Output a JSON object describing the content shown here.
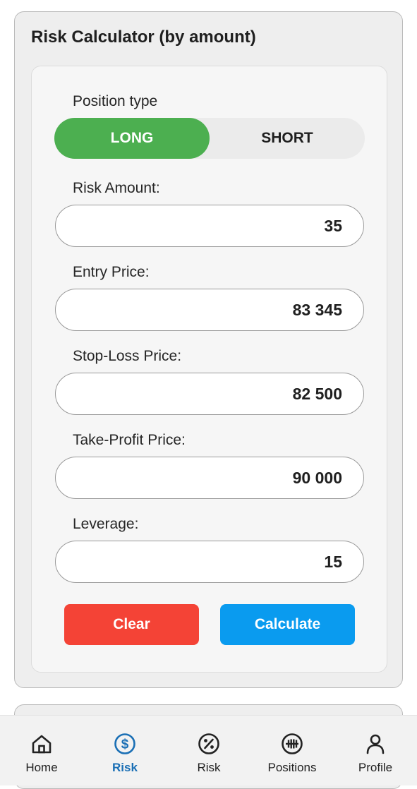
{
  "calculator": {
    "title": "Risk Calculator (by amount)",
    "position_type_label": "Position type",
    "position_options": [
      "LONG",
      "SHORT"
    ],
    "selected_position": "LONG",
    "fields": [
      {
        "label": "Risk Amount:",
        "value": "35"
      },
      {
        "label": "Entry Price:",
        "value": "83 345"
      },
      {
        "label": "Stop-Loss Price:",
        "value": "82 500"
      },
      {
        "label": "Take-Profit Price:",
        "value": "90 000"
      },
      {
        "label": "Leverage:",
        "value": "15"
      }
    ],
    "clear_label": "Clear",
    "calculate_label": "Calculate"
  },
  "nav": {
    "items": [
      {
        "label": "Home",
        "icon": "home-icon"
      },
      {
        "label": "Risk",
        "icon": "dollar-circle-icon",
        "active": true
      },
      {
        "label": "Risk",
        "icon": "percent-circle-icon"
      },
      {
        "label": "Positions",
        "icon": "positions-circle-icon"
      },
      {
        "label": "Profile",
        "icon": "person-icon"
      }
    ]
  },
  "colors": {
    "long_active": "#4caf50",
    "clear_button": "#f44336",
    "calculate_button": "#0a9bef",
    "nav_active": "#1a6fb5"
  }
}
